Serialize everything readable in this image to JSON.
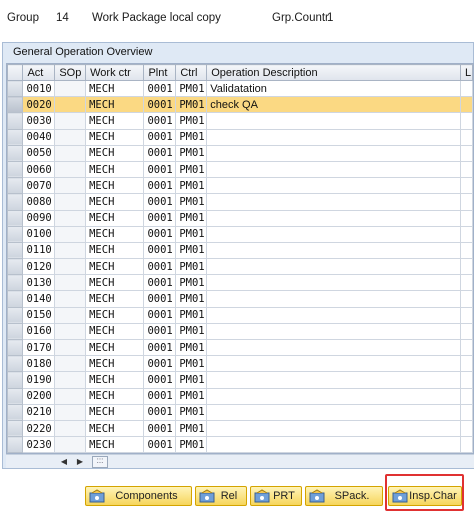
{
  "header": {
    "group_label": "Group",
    "group_value": "14",
    "package_name": "Work Package local copy",
    "counter_label": "Grp.Countr",
    "counter_value": "1"
  },
  "panel": {
    "title": "General Operation Overview"
  },
  "table": {
    "columns": [
      "Act",
      "SOp",
      "Work ctr",
      "Plnt",
      "Ctrl",
      "Operation Description",
      "L"
    ],
    "highlighted_row": 1,
    "rows": [
      {
        "act": "0010",
        "sop": "",
        "work_ctr": "MECH",
        "plnt": "0001",
        "ctrl": "PM01",
        "desc": "Validatation"
      },
      {
        "act": "0020",
        "sop": "",
        "work_ctr": "MECH",
        "plnt": "0001",
        "ctrl": "PM01",
        "desc": "check QA"
      },
      {
        "act": "0030",
        "sop": "",
        "work_ctr": "MECH",
        "plnt": "0001",
        "ctrl": "PM01",
        "desc": ""
      },
      {
        "act": "0040",
        "sop": "",
        "work_ctr": "MECH",
        "plnt": "0001",
        "ctrl": "PM01",
        "desc": ""
      },
      {
        "act": "0050",
        "sop": "",
        "work_ctr": "MECH",
        "plnt": "0001",
        "ctrl": "PM01",
        "desc": ""
      },
      {
        "act": "0060",
        "sop": "",
        "work_ctr": "MECH",
        "plnt": "0001",
        "ctrl": "PM01",
        "desc": ""
      },
      {
        "act": "0070",
        "sop": "",
        "work_ctr": "MECH",
        "plnt": "0001",
        "ctrl": "PM01",
        "desc": ""
      },
      {
        "act": "0080",
        "sop": "",
        "work_ctr": "MECH",
        "plnt": "0001",
        "ctrl": "PM01",
        "desc": ""
      },
      {
        "act": "0090",
        "sop": "",
        "work_ctr": "MECH",
        "plnt": "0001",
        "ctrl": "PM01",
        "desc": ""
      },
      {
        "act": "0100",
        "sop": "",
        "work_ctr": "MECH",
        "plnt": "0001",
        "ctrl": "PM01",
        "desc": ""
      },
      {
        "act": "0110",
        "sop": "",
        "work_ctr": "MECH",
        "plnt": "0001",
        "ctrl": "PM01",
        "desc": ""
      },
      {
        "act": "0120",
        "sop": "",
        "work_ctr": "MECH",
        "plnt": "0001",
        "ctrl": "PM01",
        "desc": ""
      },
      {
        "act": "0130",
        "sop": "",
        "work_ctr": "MECH",
        "plnt": "0001",
        "ctrl": "PM01",
        "desc": ""
      },
      {
        "act": "0140",
        "sop": "",
        "work_ctr": "MECH",
        "plnt": "0001",
        "ctrl": "PM01",
        "desc": ""
      },
      {
        "act": "0150",
        "sop": "",
        "work_ctr": "MECH",
        "plnt": "0001",
        "ctrl": "PM01",
        "desc": ""
      },
      {
        "act": "0160",
        "sop": "",
        "work_ctr": "MECH",
        "plnt": "0001",
        "ctrl": "PM01",
        "desc": ""
      },
      {
        "act": "0170",
        "sop": "",
        "work_ctr": "MECH",
        "plnt": "0001",
        "ctrl": "PM01",
        "desc": ""
      },
      {
        "act": "0180",
        "sop": "",
        "work_ctr": "MECH",
        "plnt": "0001",
        "ctrl": "PM01",
        "desc": ""
      },
      {
        "act": "0190",
        "sop": "",
        "work_ctr": "MECH",
        "plnt": "0001",
        "ctrl": "PM01",
        "desc": ""
      },
      {
        "act": "0200",
        "sop": "",
        "work_ctr": "MECH",
        "plnt": "0001",
        "ctrl": "PM01",
        "desc": ""
      },
      {
        "act": "0210",
        "sop": "",
        "work_ctr": "MECH",
        "plnt": "0001",
        "ctrl": "PM01",
        "desc": ""
      },
      {
        "act": "0220",
        "sop": "",
        "work_ctr": "MECH",
        "plnt": "0001",
        "ctrl": "PM01",
        "desc": ""
      },
      {
        "act": "0230",
        "sop": "",
        "work_ctr": "MECH",
        "plnt": "0001",
        "ctrl": "PM01",
        "desc": ""
      }
    ]
  },
  "scrollbar": {
    "left_icon": "scroll-left-icon",
    "right_icon": "scroll-right-icon",
    "thumb_glyph": ":::"
  },
  "buttons": [
    {
      "name": "components-button",
      "label": "Components",
      "icon": "components-icon"
    },
    {
      "name": "rel-button",
      "label": "Rel",
      "icon": "relationships-icon"
    },
    {
      "name": "prt-button",
      "label": "PRT",
      "icon": "prt-icon"
    },
    {
      "name": "spack-button",
      "label": "SPack.",
      "icon": "service-package-icon"
    },
    {
      "name": "insp-char-button",
      "label": "Insp.Char",
      "icon": "inspection-characteristics-icon"
    }
  ],
  "colors": {
    "row_highlight": "#fbd983",
    "button_fill": "#f6d55c",
    "callout_border": "#e03131"
  }
}
